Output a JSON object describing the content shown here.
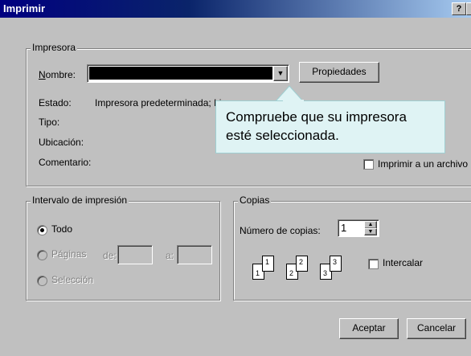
{
  "window": {
    "title": "Imprimir",
    "help_label": "?"
  },
  "printer": {
    "group_label": "Impresora",
    "name_label": "Nombre:",
    "properties_button": "Propiedades",
    "status_label": "Estado:",
    "status_value": "Impresora predeterminada; Li",
    "type_label": "Tipo:",
    "location_label": "Ubicación:",
    "comment_label": "Comentario:",
    "print_to_file": "Imprimir a un archivo"
  },
  "callout": {
    "text_line1": "Compruebe que su impresora",
    "text_line2": "esté seleccionada."
  },
  "range": {
    "group_label": "Intervalo de impresión",
    "all": "Todo",
    "pages": "Páginas",
    "from": "de:",
    "to": "a:",
    "selection": "Selección",
    "selected": "all"
  },
  "copies": {
    "group_label": "Copias",
    "count_label": "Número de copias:",
    "count_value": "1",
    "collate_label": "Intercalar",
    "collate_checked": false,
    "page_numbers": [
      "1",
      "1",
      "2",
      "2",
      "3",
      "3"
    ]
  },
  "buttons": {
    "ok": "Aceptar",
    "cancel": "Cancelar"
  }
}
